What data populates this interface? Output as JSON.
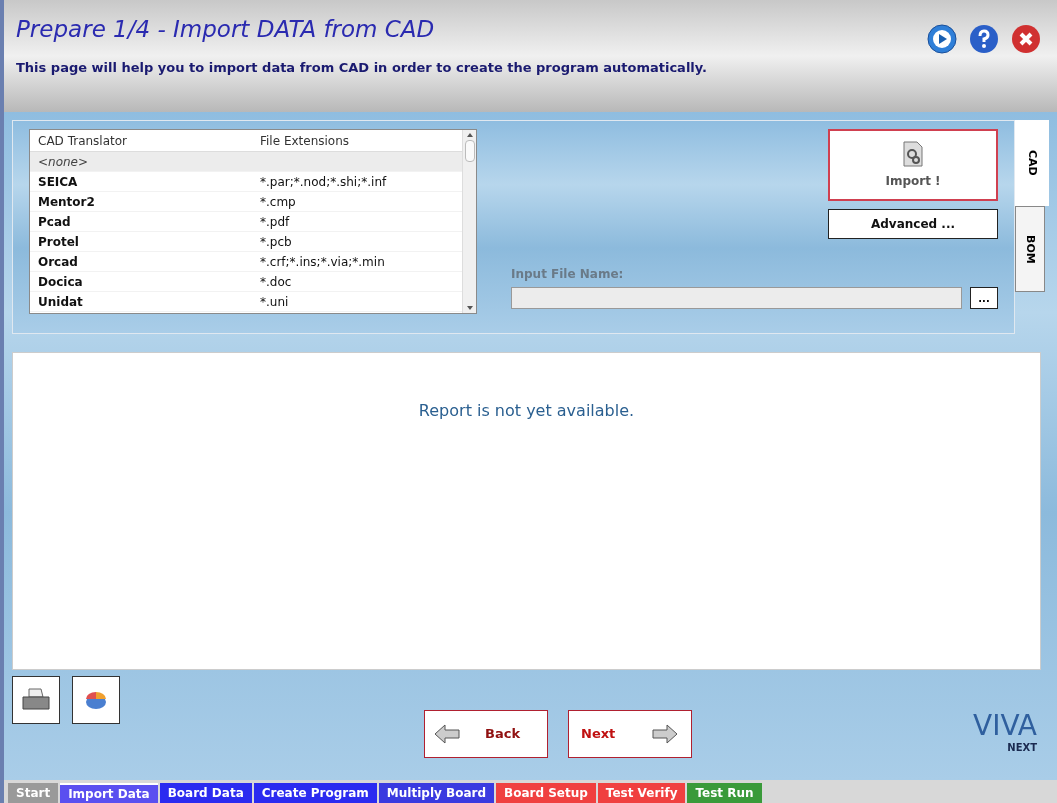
{
  "header": {
    "title": "Prepare 1/4 - Import DATA from CAD",
    "subtitle": "This page will help you to import data from CAD in order to create the program automatically."
  },
  "table": {
    "columns": [
      "CAD Translator",
      "File Extensions"
    ],
    "rows": [
      {
        "name": "<none>",
        "ext": "",
        "kind": "placeholder",
        "selected": true
      },
      {
        "name": "SEICA",
        "ext": "*.par;*.nod;*.shi;*.inf",
        "kind": "entry",
        "selected": false
      },
      {
        "name": "Mentor2",
        "ext": "*.cmp",
        "kind": "entry",
        "selected": false
      },
      {
        "name": "Pcad",
        "ext": "*.pdf",
        "kind": "entry",
        "selected": false
      },
      {
        "name": "Protel",
        "ext": "*.pcb",
        "kind": "entry",
        "selected": false
      },
      {
        "name": "Orcad",
        "ext": "*.crf;*.ins;*.via;*.min",
        "kind": "entry",
        "selected": false
      },
      {
        "name": "Docica",
        "ext": "*.doc",
        "kind": "entry",
        "selected": false
      },
      {
        "name": "Unidat",
        "ext": "*.uni",
        "kind": "entry",
        "selected": false
      }
    ]
  },
  "import_button": "Import !",
  "advanced_button": "Advanced ...",
  "input_file": {
    "label": "Input File Name:",
    "browse": "..."
  },
  "side_tabs": [
    {
      "label": "CAD",
      "selected": true
    },
    {
      "label": "BOM",
      "selected": false
    }
  ],
  "report": "Report is not yet available.",
  "back_button": "Back",
  "next_button": "Next",
  "logo": {
    "main": "VIVA",
    "sub": "NEXT"
  },
  "steps": [
    {
      "label": "Start",
      "color": "#9a9a9a",
      "selected": false
    },
    {
      "label": "Import Data",
      "color": "#5a4ff0",
      "selected": true
    },
    {
      "label": "Board Data",
      "color": "#2b2bf0",
      "selected": false
    },
    {
      "label": "Create Program",
      "color": "#2b2bf0",
      "selected": false
    },
    {
      "label": "Multiply Board",
      "color": "#3a3ae0",
      "selected": false
    },
    {
      "label": "Board Setup",
      "color": "#f04040",
      "selected": false
    },
    {
      "label": "Test Verify",
      "color": "#f04040",
      "selected": false
    },
    {
      "label": "Test Run",
      "color": "#3a9a3a",
      "selected": false
    }
  ]
}
